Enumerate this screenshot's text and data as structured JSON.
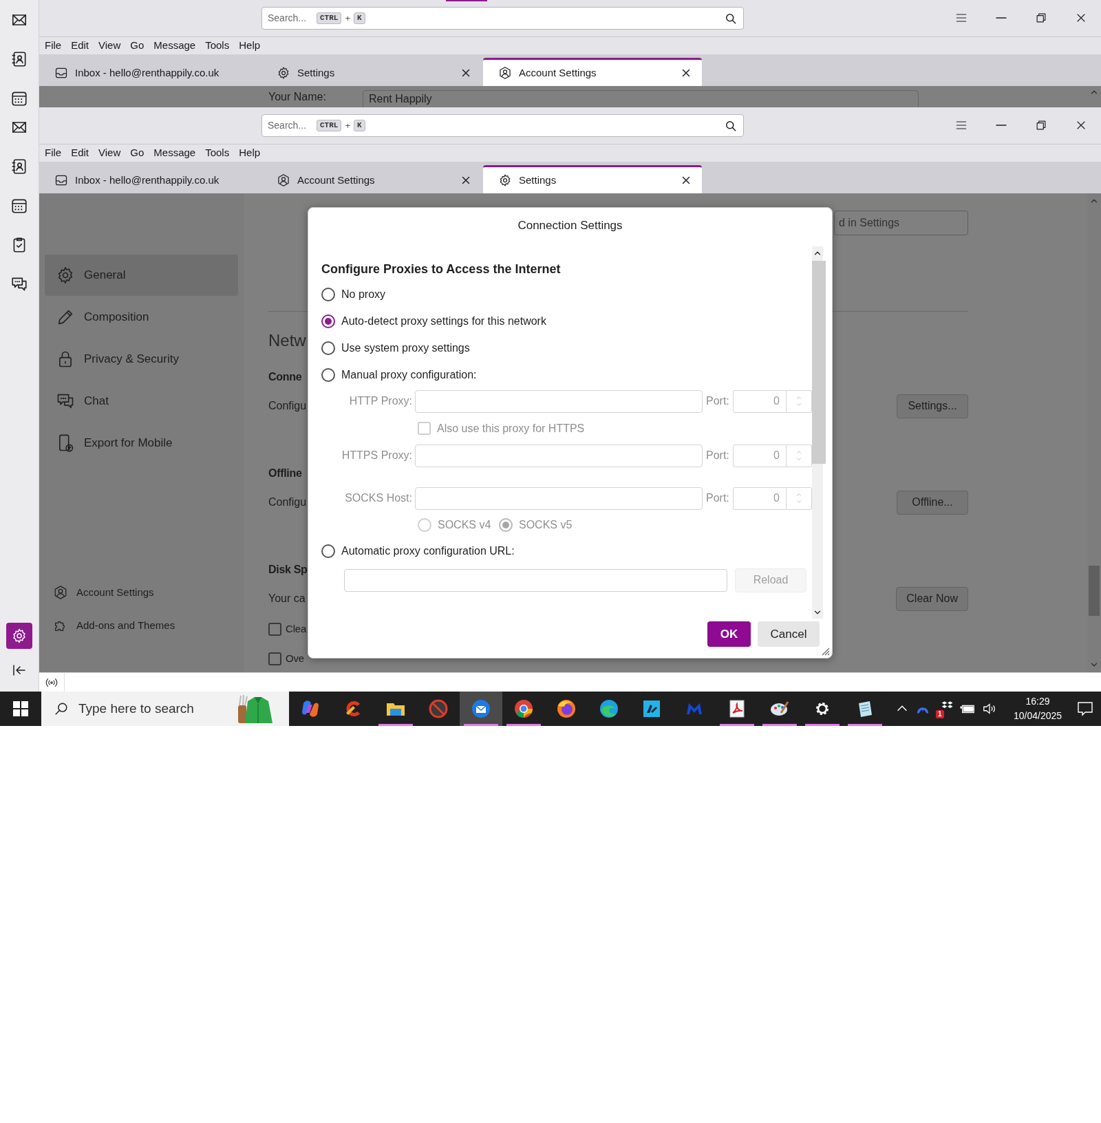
{
  "back_window": {
    "search": {
      "placeholder": "Search...",
      "keys": [
        {
          "kind": "key",
          "text": "CTRL"
        },
        {
          "kind": "plus",
          "text": "+"
        },
        {
          "kind": "key",
          "text": "K"
        }
      ]
    },
    "menu": [
      "File",
      "Edit",
      "View",
      "Go",
      "Message",
      "Tools",
      "Help"
    ],
    "tabs": [
      {
        "label": "Inbox - hello@renthappily.co.uk",
        "selected": false,
        "closable": false
      },
      {
        "label": "Settings",
        "selected": false,
        "closable": true
      },
      {
        "label": "Account Settings",
        "selected": true,
        "closable": true
      }
    ],
    "field": {
      "label": "Your Name:",
      "value": "Rent Happily"
    }
  },
  "front_window": {
    "search": {
      "placeholder": "Search...",
      "keys": [
        {
          "kind": "key",
          "text": "CTRL"
        },
        {
          "kind": "plus",
          "text": "+"
        },
        {
          "kind": "key",
          "text": "K"
        }
      ]
    },
    "menu": [
      "File",
      "Edit",
      "View",
      "Go",
      "Message",
      "Tools",
      "Help"
    ],
    "tabs": [
      {
        "label": "Inbox - hello@renthappily.co.uk",
        "selected": false,
        "closable": false
      },
      {
        "label": "Account Settings",
        "selected": false,
        "closable": true
      },
      {
        "label": "Settings",
        "selected": true,
        "closable": true
      }
    ],
    "sidebar": {
      "items": [
        {
          "label": "General",
          "selected": true
        },
        {
          "label": "Composition",
          "selected": false
        },
        {
          "label": "Privacy & Security",
          "selected": false
        },
        {
          "label": "Chat",
          "selected": false
        },
        {
          "label": "Export for Mobile",
          "selected": false
        }
      ],
      "footer_items": [
        {
          "label": "Account Settings"
        },
        {
          "label": "Add-ons and Themes"
        }
      ]
    },
    "page": {
      "search": {
        "placeholder": "d in Settings"
      },
      "lines": [
        {
          "kind": "title",
          "text": "Netw"
        },
        {
          "kind": "heading",
          "text": "Conne"
        },
        {
          "kind": "text",
          "text": "Configu",
          "button": "Settings..."
        },
        {
          "kind": "heading",
          "text": "Offline"
        },
        {
          "kind": "text",
          "text": "Configu",
          "button": "Offline..."
        },
        {
          "kind": "heading",
          "text": "Disk Sp"
        },
        {
          "kind": "text",
          "text": "Your ca",
          "button": "Clear Now"
        },
        {
          "kind": "checkbox",
          "text": "Clea",
          "checked": false
        },
        {
          "kind": "checkbox",
          "text": "Ove",
          "checked": false
        }
      ]
    },
    "dialog": {
      "title": "Connection Settings",
      "heading": "Configure Proxies to Access the Internet",
      "options": [
        {
          "label": "No proxy",
          "selected": false
        },
        {
          "label": "Auto-detect proxy settings for this network",
          "selected": true
        },
        {
          "label": "Use system proxy settings",
          "selected": false
        },
        {
          "label": "Manual proxy configuration:",
          "selected": false
        }
      ],
      "manual": {
        "disabled": true,
        "rows": [
          {
            "label": "HTTP Proxy:",
            "port_label": "Port:",
            "port": "0"
          },
          {
            "label": "HTTPS Proxy:",
            "port_label": "Port:",
            "port": "0"
          },
          {
            "label": "SOCKS Host:",
            "port_label": "Port:",
            "port": "0"
          }
        ],
        "also_https": {
          "label": "Also use this proxy for HTTPS",
          "checked": false
        },
        "socks_versions": [
          {
            "label": "SOCKS v4",
            "selected": false
          },
          {
            "label": "SOCKS v5",
            "selected": true
          }
        ]
      },
      "auto_url": {
        "label": "Automatic proxy configuration URL:",
        "selected": false,
        "reload": "Reload"
      },
      "buttons": [
        {
          "label": "OK",
          "kind": "primary"
        },
        {
          "label": "Cancel",
          "kind": "secondary"
        }
      ]
    }
  },
  "taskbar": {
    "search_placeholder": "Type here to search",
    "apps": [
      {
        "kind": "copilot",
        "running": false,
        "active": false
      },
      {
        "kind": "ccleaner",
        "running": false,
        "active": false
      },
      {
        "kind": "explorer",
        "running": true,
        "active": false
      },
      {
        "kind": "blocked",
        "running": false,
        "active": false
      },
      {
        "kind": "thunderbird",
        "running": true,
        "active": true
      },
      {
        "kind": "chrome",
        "running": true,
        "active": false
      },
      {
        "kind": "firefox",
        "running": false,
        "active": false
      },
      {
        "kind": "edge",
        "running": false,
        "active": false
      },
      {
        "kind": "feed",
        "running": false,
        "active": false
      },
      {
        "kind": "malware",
        "running": false,
        "active": false
      },
      {
        "kind": "pdf",
        "running": true,
        "active": false
      },
      {
        "kind": "paint",
        "running": true,
        "active": false
      },
      {
        "kind": "settings",
        "running": true,
        "active": false
      },
      {
        "kind": "notepad",
        "running": true,
        "active": false
      }
    ],
    "tray_badge": "1",
    "time": "16:29",
    "date": "10/04/2025"
  }
}
